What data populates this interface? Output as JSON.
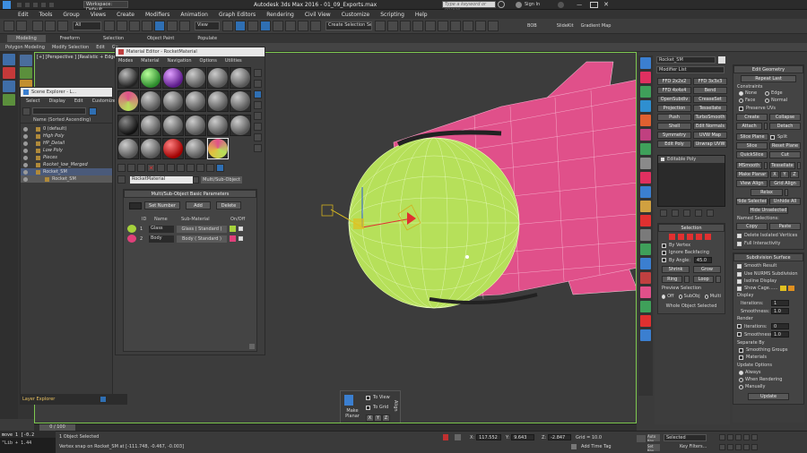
{
  "title_bar": {
    "workspace": "Workspace: Default",
    "title": "Autodesk 3ds Max 2016 - 01_09_Exports.max",
    "search_placeholder": "Type a keyword or phrase",
    "sign_in": "Sign In"
  },
  "menu": [
    "Edit",
    "Tools",
    "Group",
    "Views",
    "Create",
    "Modifiers",
    "Animation",
    "Graph Editors",
    "Rendering",
    "Civil View",
    "Customize",
    "Scripting",
    "Help"
  ],
  "toolbar": {
    "filter": "All",
    "view": "View",
    "selection_set": "Create Selection Se",
    "bob": "BOB",
    "slidekit": "SlideKit",
    "gradient_map": "Gradient Map"
  },
  "ribbon": {
    "tabs": [
      "Modeling",
      "Freeform",
      "Selection",
      "Object Paint",
      "Populate"
    ],
    "sub_items": [
      "Polygon Modeling",
      "Modify Selection",
      "Edit",
      "Ge"
    ]
  },
  "viewport": {
    "label": "[+] [Perspective ] [Realistic + Edged Faces ]"
  },
  "scene_explorer": {
    "title": "Scene Explorer - L...",
    "menu": [
      "Select",
      "Display",
      "Edit",
      "Customize"
    ],
    "header": "Name (Sorted Ascending)",
    "items": [
      "0 (default)",
      "High Poly",
      "HP_Detail",
      "Low Poly",
      "Pieces",
      "Rocket_low_Merged",
      "Rocket_SM",
      "Rocket_SM"
    ],
    "layer_explorer": "Layer Explorer"
  },
  "material_editor": {
    "title": "Material Editor - RocketMaterial",
    "menu": [
      "Modes",
      "Material",
      "Navigation",
      "Options",
      "Utilities"
    ],
    "material_name": "RocketMaterial",
    "material_type": "Multi/Sub-Object",
    "panel_title": "Multi/Sub-Object Basic Parameters",
    "set_number": "Set Number",
    "add": "Add",
    "delete": "Delete",
    "columns": [
      "ID",
      "Name",
      "Sub-Material",
      "On/Off"
    ],
    "rows": [
      {
        "id": "1",
        "name": "Glass",
        "sub": "Glass ( Standard )",
        "swatch": "#a6d23c"
      },
      {
        "id": "2",
        "name": "Body",
        "sub": "Body ( Standard )",
        "swatch": "#e0407a"
      }
    ]
  },
  "make_planar": {
    "label": "Make Planar",
    "to_view": "To View",
    "to_grid": "To Grid",
    "axes": [
      "X",
      "Y",
      "Z"
    ],
    "align": "Align"
  },
  "command_panel": {
    "object_name": "Rocket_SM",
    "modifier_list": "Modifier List",
    "modifier_buttons": [
      "FFD 2x2x2",
      "FFD 3x3x3",
      "FFD 4x4x4",
      "Bend",
      "OpenSubdiv",
      "CreaseSet",
      "Projection",
      "Tessellate",
      "Push",
      "TurboSmooth",
      "Shell",
      "Edit Normals",
      "Symmetry",
      "UVW Map",
      "Edit Poly",
      "Unwrap UVW"
    ],
    "stack_item": "Editable Poly",
    "selection_title": "Selection",
    "by_vertex": "By Vertex",
    "ignore_backfacing": "Ignore Backfacing",
    "by_angle": "By Angle:",
    "by_angle_value": "45.0",
    "shrink": "Shrink",
    "grow": "Grow",
    "ring": "Ring",
    "loop": "Loop",
    "preview_selection": "Preview Selection",
    "preview_opts": [
      "Off",
      "SubObj",
      "Multi"
    ],
    "whole_object": "Whole Object Selected"
  },
  "edit_geometry": {
    "title": "Edit Geometry",
    "repeat_last": "Repeat Last",
    "constraints": "Constraints",
    "constraint_opts": [
      "None",
      "Edge",
      "Face",
      "Normal"
    ],
    "preserve_uvs": "Preserve UVs",
    "create": "Create",
    "collapse": "Collapse",
    "attach": "Attach",
    "detach": "Detach",
    "slice_plane": "Slice Plane",
    "split": "Split",
    "slice": "Slice",
    "reset_plane": "Reset Plane",
    "quickslice": "QuickSlice",
    "cut": "Cut",
    "msmooth": "MSmooth",
    "tessellate": "Tessellate",
    "make_planar": "Make Planar",
    "view_align": "View Align",
    "grid_align": "Grid Align",
    "relax": "Relax",
    "hide_selected": "Hide Selected",
    "unhide_all": "Unhide All",
    "hide_unselected": "Hide Unselected",
    "named_selections": "Named Selections:",
    "copy": "Copy",
    "paste": "Paste",
    "delete_isolated": "Delete Isolated Vertices",
    "full_interactivity": "Full Interactivity"
  },
  "subdivision": {
    "title": "Subdivision Surface",
    "smooth_result": "Smooth Result",
    "use_nurms": "Use NURMS Subdivision",
    "isoline_display": "Isoline Display",
    "show_cage": "Show Cage......",
    "display": "Display",
    "iterations": "Iterations:",
    "iterations_value": "1",
    "smoothness": "Smoothness:",
    "smoothness_value": "1.0",
    "render": "Render",
    "render_iterations_value": "0",
    "render_smoothness_value": "1.0",
    "separate_by": "Separate By",
    "smoothing_groups": "Smoothing Groups",
    "materials": "Materials",
    "update_options": "Update Options",
    "update_opts": [
      "Always",
      "When Rendering",
      "Manually"
    ],
    "update": "Update"
  },
  "status": {
    "maxscript1": "move 1 [-0.2",
    "maxscript2": "\"Lib + 1.44",
    "objects_selected": "1 Object Selected",
    "prompt": "Vertex snap on Rocket_SM at [-111.748, -0.467, -0.003]",
    "frame": "0 / 100",
    "x": "117.552",
    "y": "9.643",
    "z": "-2.847",
    "grid": "Grid = 10.0",
    "add_time_tag": "Add Time Tag",
    "auto_key": "Auto Key",
    "selected": "Selected",
    "set_key": "Set Key",
    "key_filters": "Key Filters..."
  },
  "colors": {
    "pink": "#e0508a",
    "glass": "#b6e05a",
    "accent_blue": "#2f6fb3",
    "viewport_bg": "#3c3c3c"
  }
}
